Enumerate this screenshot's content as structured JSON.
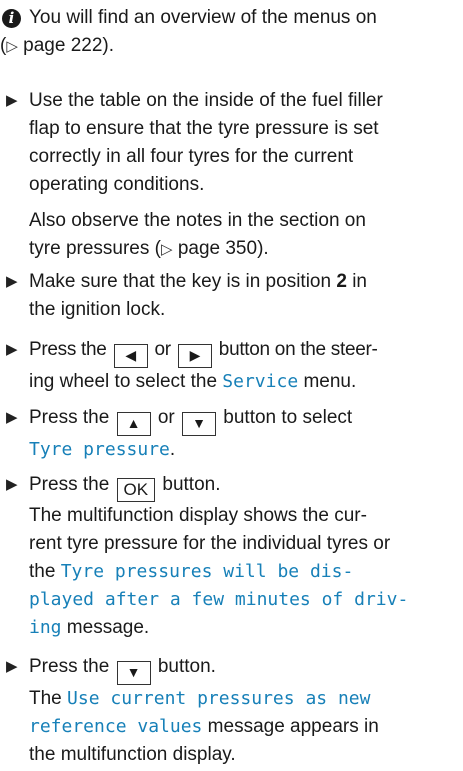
{
  "info": {
    "line1": "You will find an overview of the menus on",
    "line2": "page 222",
    "line2_close": ")."
  },
  "s1": {
    "lines": [
      "Use the table on the inside of the fuel filler",
      "flap to ensure that the tyre pressure is set",
      "correctly in all four tyres for the current",
      "operating conditions."
    ],
    "note_line1": "Also observe the notes in the section on",
    "note_line2": "tyre pressures (",
    "note_page": "page 350",
    "note_close": ")."
  },
  "s2": {
    "pre": "Make sure that the key is in position",
    "num": "2",
    "post": "in",
    "line2": "the ignition lock."
  },
  "s3": {
    "press": "Press the",
    "or": "or",
    "after": "button on the steer-",
    "line2": "ing wheel to select the",
    "menu": "Service",
    "menu_suffix": "menu."
  },
  "s4": {
    "press": "Press the",
    "or": "or",
    "after": "button to select",
    "item": "Tyre pressure",
    "item_suffix": "."
  },
  "s5": {
    "press": "Press the",
    "key": "OK",
    "after": "button.",
    "lines": [
      "The multifunction display shows the cur-",
      "rent tyre pressure for the individual tyres or"
    ],
    "the": "the",
    "msg1": "Tyre pressures will be dis-",
    "msg2": "played after a few minutes of driv-",
    "msg3": "ing",
    "msg_suffix": "message."
  },
  "s6": {
    "press": "Press the",
    "after": "button.",
    "the": "The",
    "msg1": "Use current pressures as new",
    "msg2": "reference values",
    "msg_suffix": "message appears in",
    "line4": "the multifunction display."
  },
  "glyphs": {
    "info": "i",
    "bullet": "▶",
    "page_ref": "▷",
    "left_key": "◀",
    "right_key": "▶",
    "up_key": "▲",
    "down_key": "▼"
  },
  "colors": {
    "display_text": "#1780b8"
  }
}
